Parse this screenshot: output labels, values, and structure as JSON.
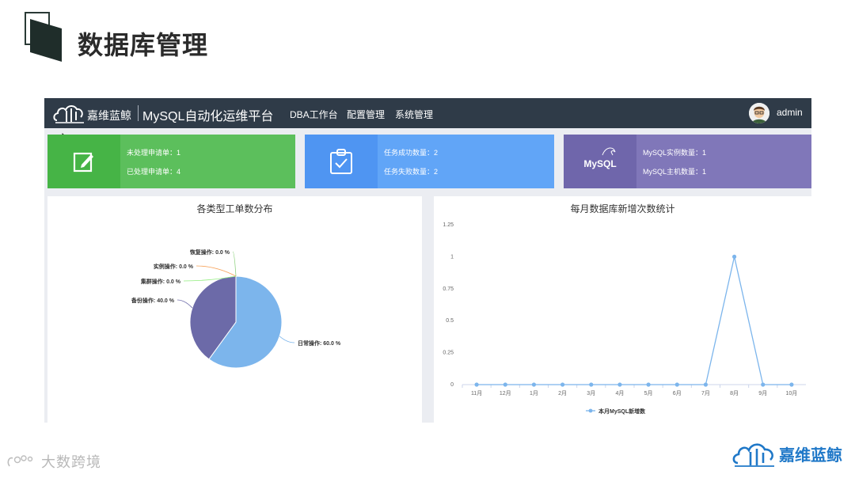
{
  "slide": {
    "title": "数据库管理",
    "footer_left": "大数跨境",
    "footer_right": "嘉维蓝鲸"
  },
  "navbar": {
    "brand": "嘉维蓝鲸",
    "app_title": "MySQL自动化运维平台",
    "items": [
      {
        "label": "DBA工作台"
      },
      {
        "label": "配置管理"
      },
      {
        "label": "系统管理"
      }
    ],
    "user": "admin"
  },
  "cards": [
    {
      "icon": "edit-icon",
      "lines": [
        "未处理申请单：1",
        "已处理申请单：4"
      ],
      "color": "#5cbf5c"
    },
    {
      "icon": "clipboard-check-icon",
      "lines": [
        "任务成功数量：2",
        "任务失败数量：2"
      ],
      "color": "#61a5f7"
    },
    {
      "icon": "mysql-logo",
      "logo_text": "MySQL",
      "lines": [
        "MySQL实例数量：1",
        "MySQL主机数量：1"
      ],
      "color": "#8077b9"
    }
  ],
  "chart_data": [
    {
      "type": "pie",
      "title": "各类型工单数分布",
      "slices": [
        {
          "label": "日常操作",
          "percent": 60.0,
          "display": "日常操作: 60.0 %",
          "color": "#7cb5ec"
        },
        {
          "label": "备份操作",
          "percent": 40.0,
          "display": "备份操作: 40.0 %",
          "color": "#6c6aa8"
        },
        {
          "label": "集群操作",
          "percent": 0.0,
          "display": "集群操作: 0.0 %",
          "color": "#90ed7d"
        },
        {
          "label": "实例操作",
          "percent": 0.0,
          "display": "实例操作: 0.0 %",
          "color": "#f7a35c"
        },
        {
          "label": "恢复操作",
          "percent": 0.0,
          "display": "恢复操作: 0.0 %",
          "color": "#8dd17e"
        }
      ]
    },
    {
      "type": "line",
      "title": "每月数据库新增次数统计",
      "categories": [
        "11月",
        "12月",
        "1月",
        "2月",
        "3月",
        "4月",
        "5月",
        "6月",
        "7月",
        "8月",
        "9月",
        "10月"
      ],
      "series": [
        {
          "name": "本月MySQL新增数",
          "values": [
            0,
            0,
            0,
            0,
            0,
            0,
            0,
            0,
            0,
            1,
            0,
            0
          ],
          "color": "#7cb5ec"
        }
      ],
      "ylim": [
        0,
        1.25
      ],
      "yticks": [
        "0",
        "0.25",
        "0.5",
        "0.75",
        "1",
        "1.25"
      ],
      "grid": false,
      "legend": "bottom-center"
    }
  ]
}
